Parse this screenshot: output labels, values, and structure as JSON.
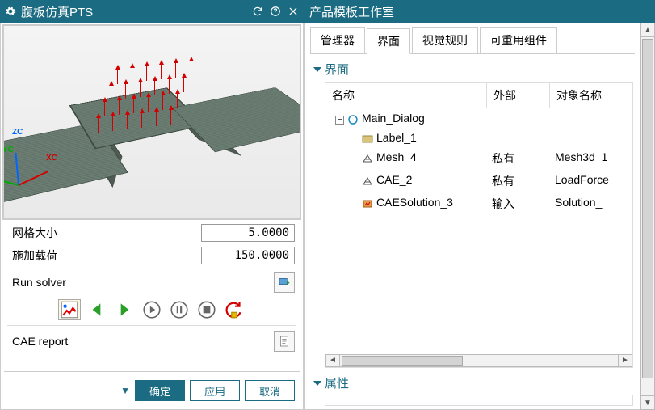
{
  "left": {
    "title": "腹板仿真PTS",
    "params": {
      "mesh_label": "网格大小",
      "mesh_value": "5.0000",
      "load_label": "施加载荷",
      "load_value": "150.0000"
    },
    "solver_label": "Run solver",
    "cae_report_label": "CAE report",
    "buttons": {
      "ok": "确定",
      "apply": "应用",
      "cancel": "取消"
    },
    "triad": {
      "x": "XC",
      "y": "YC",
      "z": "ZC"
    }
  },
  "right": {
    "title": "产品模板工作室",
    "tabs": [
      "管理器",
      "界面",
      "视觉规则",
      "可重用组件"
    ],
    "active_tab": 1,
    "sections": {
      "interface": "界面",
      "attributes": "属性"
    },
    "columns": {
      "name": "名称",
      "external": "外部",
      "obj_name": "对象名称"
    },
    "tree": [
      {
        "indent": 0,
        "toggle": "-",
        "icon": "circle",
        "label": "Main_Dialog",
        "external": "",
        "obj": ""
      },
      {
        "indent": 1,
        "toggle": "",
        "icon": "label",
        "label": "Label_1",
        "external": "",
        "obj": ""
      },
      {
        "indent": 1,
        "toggle": "",
        "icon": "mesh",
        "label": "Mesh_4",
        "external": "私有",
        "obj": "Mesh3d_1"
      },
      {
        "indent": 1,
        "toggle": "",
        "icon": "mesh",
        "label": "CAE_2",
        "external": "私有",
        "obj": "LoadForce"
      },
      {
        "indent": 1,
        "toggle": "",
        "icon": "solution",
        "label": "CAESolution_3",
        "external": "输入",
        "obj": "Solution_"
      }
    ]
  }
}
